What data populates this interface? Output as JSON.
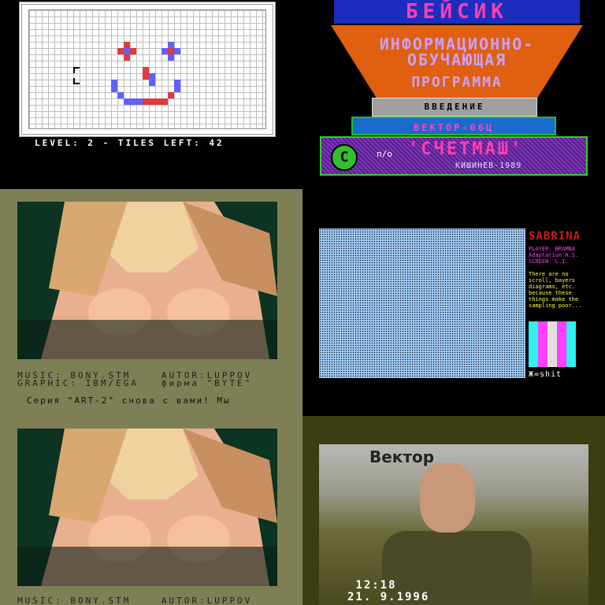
{
  "game": {
    "status": "LEVEL: 2  -  TILES LEFT: 42"
  },
  "basic": {
    "title": "БЕЙСИК",
    "line1": "ИНФОРМАЦИОННО-",
    "line2": "ОБУЧАЮЩАЯ",
    "line3": "ПРОГРАММА",
    "intro": "ВВЕДЕНИЕ",
    "vector": "ВЕКТОР-06Ц",
    "circle": "С",
    "po": "п/о",
    "company": "'СЧЕТМАШ'",
    "city_year": "КИШИНЕВ-1989"
  },
  "art": {
    "credit_line1": "MUSIC: BONY.STM    AUTOR:LUPPOV",
    "credit_line2": "GRAPHIC: IBM/EGA   фирма \"BYTE\"",
    "scroll_text": "Серия \"ART-2\" снова с вами! Мы",
    "credit_line1_repeat": "MUSIC: BONY.STM    AUTOR:LUPPOV"
  },
  "sabrina": {
    "title": "SABRINA",
    "player": "PLAYER: BRAMBA",
    "adaptation": "Adaptation:H.S.",
    "screen": "SCREEN: L.I.",
    "note": "There are no scroll, bayers diagrams, etc. because these things make the sampling poor...",
    "signature": "Ж=shit",
    "bar_colors": [
      "#30f0f0",
      "#ff40ff",
      "#e0e0e0",
      "#ff40ff",
      "#30f0f0"
    ]
  },
  "vektor": {
    "sign": "Вектор",
    "timestamp": " 12:18\n21. 9.1996"
  }
}
